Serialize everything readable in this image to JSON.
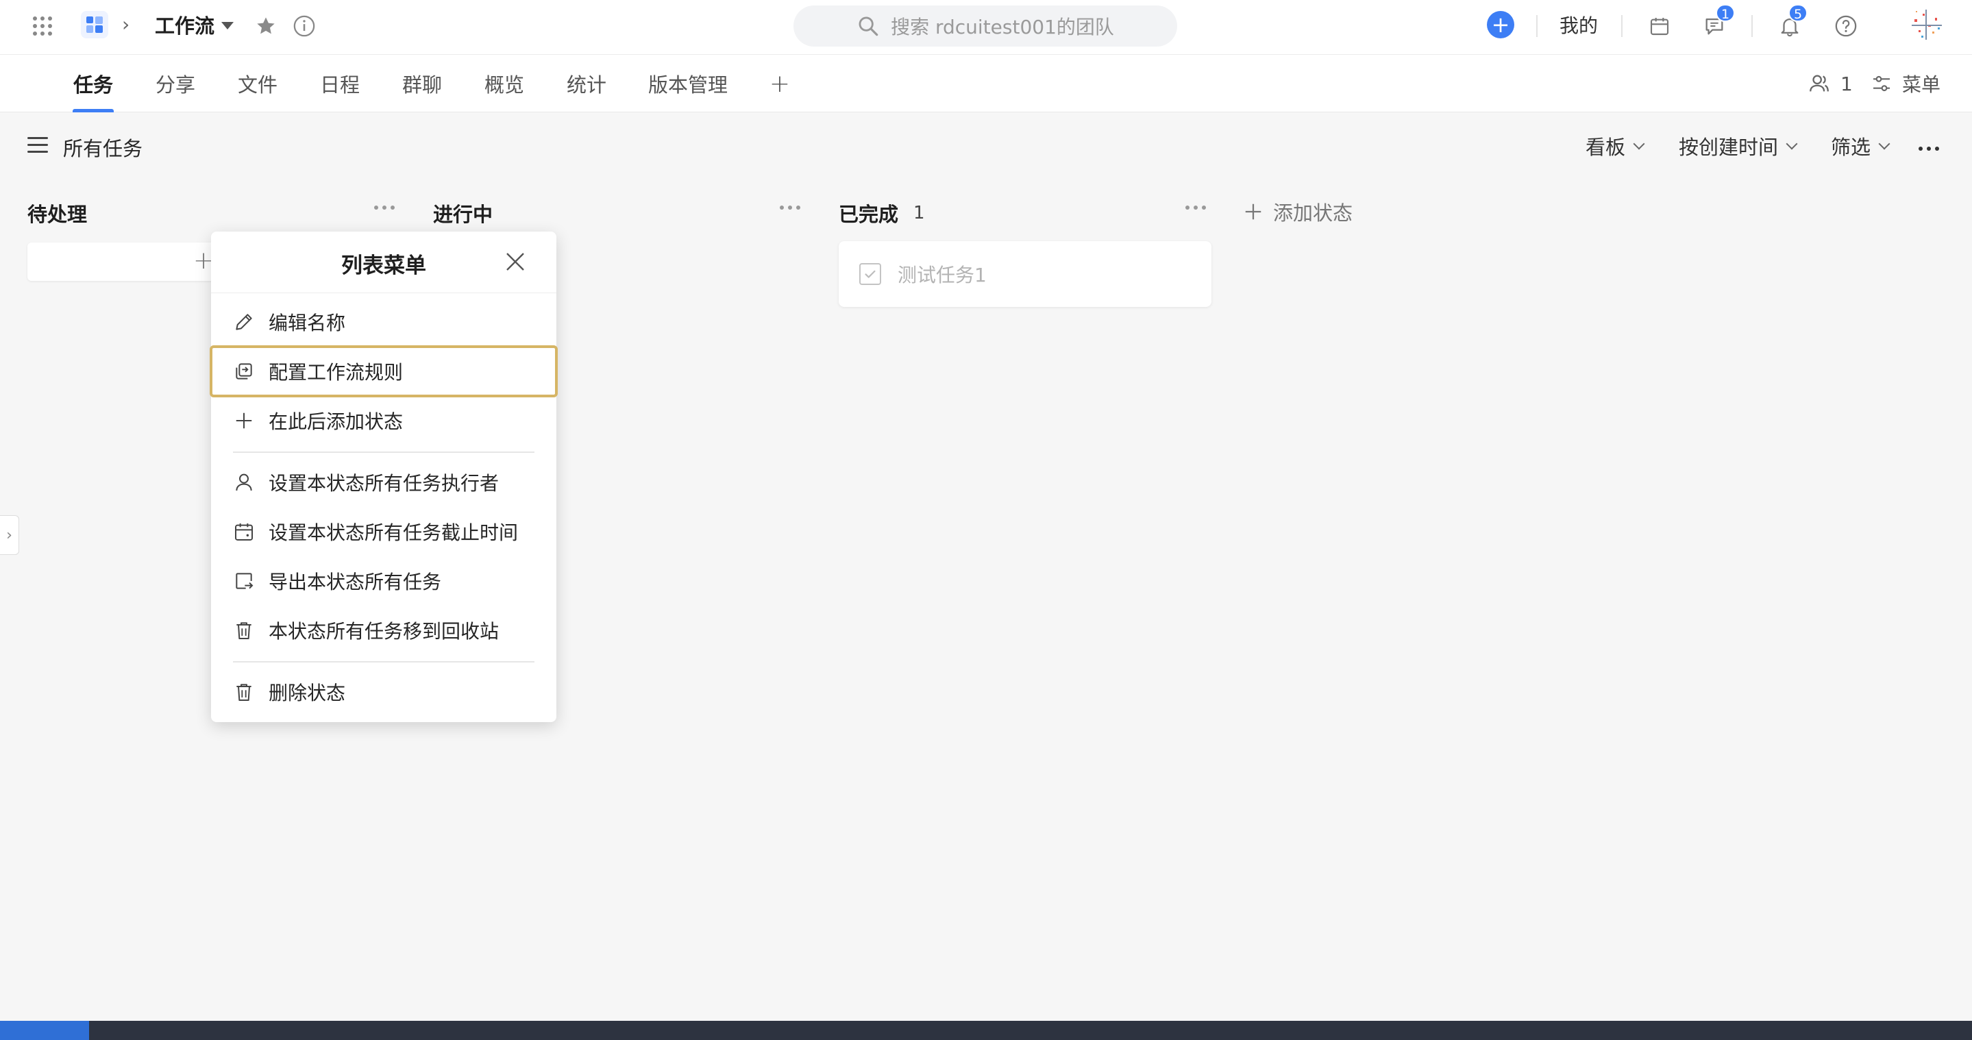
{
  "topbar": {
    "project_name": "工作流",
    "search_placeholder": "搜索 rdcuitest001的团队",
    "mine_label": "我的",
    "messages_badge": "1",
    "notifications_badge": "5",
    "accent_color": "#3d7ef5"
  },
  "tabs": [
    {
      "label": "任务",
      "active": true
    },
    {
      "label": "分享"
    },
    {
      "label": "文件"
    },
    {
      "label": "日程"
    },
    {
      "label": "群聊"
    },
    {
      "label": "概览"
    },
    {
      "label": "统计"
    },
    {
      "label": "版本管理"
    }
  ],
  "tabbar_right": {
    "members_count": "1",
    "menu_label": "菜单"
  },
  "subheader": {
    "title": "所有任务",
    "view_label": "看板",
    "sort_label": "按创建时间",
    "filter_label": "筛选"
  },
  "columns": [
    {
      "title": "待处理",
      "count": ""
    },
    {
      "title": "进行中",
      "count": ""
    },
    {
      "title": "已完成",
      "count": "1"
    }
  ],
  "task": {
    "name": "测试任务1"
  },
  "add_status_label": "添加状态",
  "list_menu": {
    "title": "列表菜单",
    "items": [
      {
        "label": "编辑名称",
        "icon": "pencil-icon"
      },
      {
        "label": "配置工作流规则",
        "icon": "workflow-rule-icon",
        "highlighted": true
      },
      {
        "label": "在此后添加状态",
        "icon": "plus-icon"
      },
      {
        "label": "设置本状态所有任务执行者",
        "icon": "user-icon"
      },
      {
        "label": "设置本状态所有任务截止时间",
        "icon": "calendar-icon"
      },
      {
        "label": "导出本状态所有任务",
        "icon": "export-icon"
      },
      {
        "label": "本状态所有任务移到回收站",
        "icon": "trash-icon"
      },
      {
        "label": "删除状态",
        "icon": "trash-icon"
      }
    ]
  }
}
